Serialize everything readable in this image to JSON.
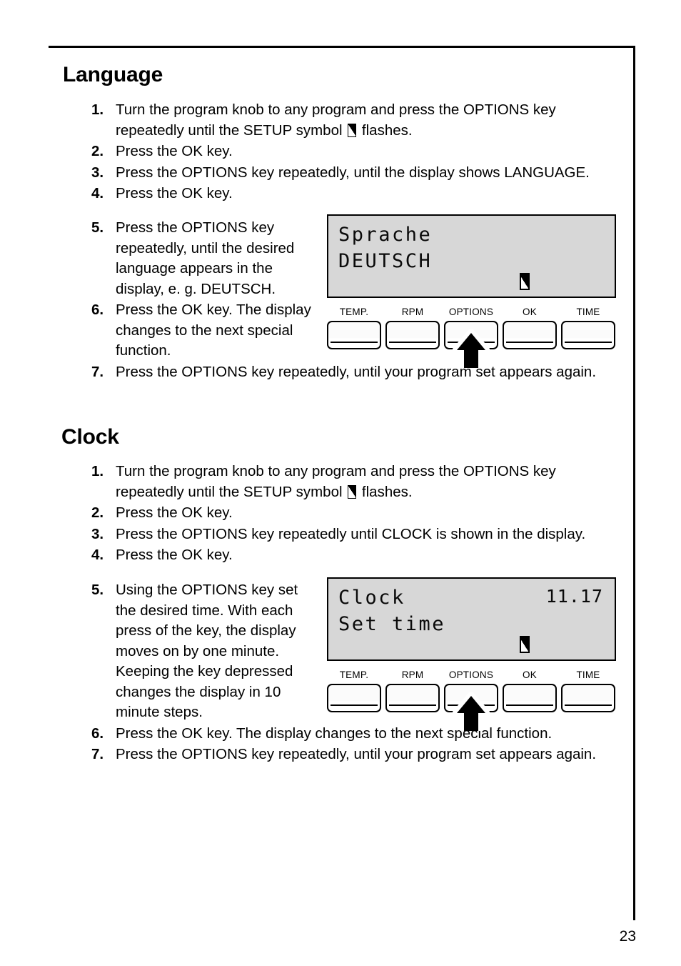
{
  "page": {
    "number": "23"
  },
  "sections": [
    {
      "id": "language",
      "title": "Language",
      "steps_before": [
        {
          "num": "1.",
          "text": "Turn the program knob to any program and press the OPTIONS key repeatedly until the SETUP symbol   flashes.",
          "parts": [
            "Turn the program knob to any program and press the OPTIONS key repeatedly until the SETUP symbol ",
            " flashes."
          ]
        },
        {
          "num": "2.",
          "text": "Press the OK key."
        },
        {
          "num": "3.",
          "text": "Press the OPTIONS key repeatedly, until the display shows LANGUAGE."
        },
        {
          "num": "4.",
          "text": "Press the OK key."
        }
      ],
      "steps_after": [
        {
          "num": "5.",
          "text": "Press the OPTIONS key repeatedly, until the desired language appears in the display, e. g. DEUTSCH."
        },
        {
          "num": "6.",
          "text": "Press the OK key. The display changes to the next special function."
        },
        {
          "num": "7.",
          "text": "Press the OPTIONS key repeatedly, until your program set appears again."
        }
      ],
      "display": {
        "line1": "Sprache",
        "line2": "DEUTSCH",
        "time": "",
        "setup_symbol": true
      }
    },
    {
      "id": "clock",
      "title": "Clock",
      "steps_before": [
        {
          "num": "1.",
          "text": "Turn the program knob to any program and press the OPTIONS key repeatedly until the SETUP symbol   flashes.",
          "parts": [
            "Turn the program knob to any program and press the OPTIONS key repeatedly until the SETUP symbol ",
            " flashes."
          ]
        },
        {
          "num": "2.",
          "text": "Press the OK key."
        },
        {
          "num": "3.",
          "text": "Press the OPTIONS key repeatedly until CLOCK is shown in the display."
        },
        {
          "num": "4.",
          "text": "Press the OK key."
        }
      ],
      "steps_after": [
        {
          "num": "5.",
          "text": "Using the OPTIONS key set the desired time. With each press of the key, the display moves on by one minute. Keeping the key depressed changes the display in 10 minute steps."
        },
        {
          "num": "6.",
          "text": "Press the OK key. The display changes to the next special function."
        },
        {
          "num": "7.",
          "text": "Press the OPTIONS key repeatedly, until your program set appears again."
        }
      ],
      "display": {
        "line1": "Clock",
        "line2": "Set time",
        "time": "11.17",
        "setup_symbol": true
      }
    }
  ],
  "control_panel": {
    "keys": [
      {
        "label": "TEMP."
      },
      {
        "label": "RPM"
      },
      {
        "label": "OPTIONS"
      },
      {
        "label": "OK"
      },
      {
        "label": "TIME"
      }
    ],
    "pointer_target": "OPTIONS"
  },
  "colors": {
    "text": "#000000",
    "page_background": "#ffffff",
    "lcd_background": "#d7d7d7",
    "key_face": "#fbfbfb"
  }
}
